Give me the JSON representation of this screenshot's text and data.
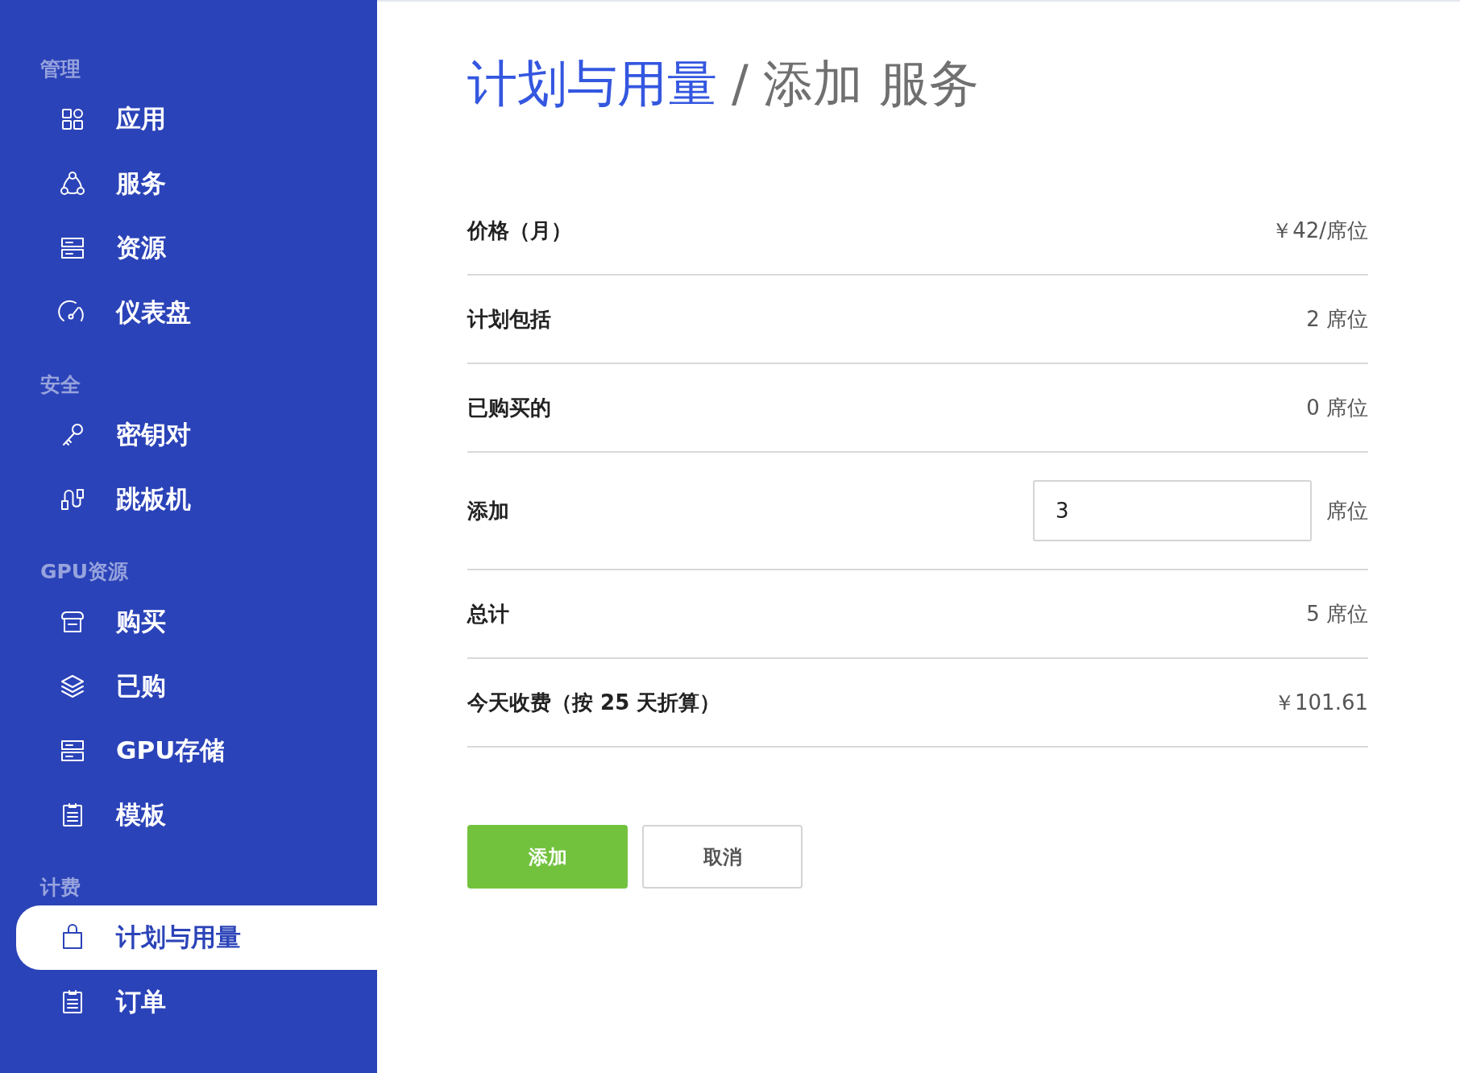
{
  "sidebar": {
    "sections": [
      {
        "heading": "管理",
        "items": [
          {
            "label": "应用",
            "kind": "grid",
            "selected": false
          },
          {
            "label": "服务",
            "kind": "nodes",
            "selected": false
          },
          {
            "label": "资源",
            "kind": "server",
            "selected": false
          },
          {
            "label": "仪表盘",
            "kind": "gauge",
            "selected": false
          }
        ]
      },
      {
        "heading": "安全",
        "items": [
          {
            "label": "密钥对",
            "kind": "key",
            "selected": false
          },
          {
            "label": "跳板机",
            "kind": "jump",
            "selected": false
          }
        ]
      },
      {
        "heading": "GPU资源",
        "items": [
          {
            "label": "购买",
            "kind": "store",
            "selected": false
          },
          {
            "label": "已购",
            "kind": "layers",
            "selected": false
          },
          {
            "label": "GPU存储",
            "kind": "server",
            "selected": false
          },
          {
            "label": "模板",
            "kind": "clipboard",
            "selected": false
          }
        ]
      },
      {
        "heading": "计费",
        "items": [
          {
            "label": "计划与用量",
            "kind": "bag",
            "selected": true
          },
          {
            "label": "订单",
            "kind": "clipboard",
            "selected": false
          }
        ]
      }
    ]
  },
  "breadcrumb": {
    "link": "计划与用量",
    "separator": "/",
    "current": "添加 服务"
  },
  "rows": [
    {
      "kind": "static",
      "label": "价格（月）",
      "value": "￥42/席位"
    },
    {
      "kind": "static",
      "label": "计划包括",
      "value": "2 席位"
    },
    {
      "kind": "static",
      "label": "已购买的",
      "value": "0 席位"
    },
    {
      "kind": "input",
      "label": "添加",
      "value": "3",
      "unit": "席位"
    },
    {
      "kind": "static",
      "label": "总计",
      "value": "5 席位"
    },
    {
      "kind": "static",
      "label": "今天收费（按 25 天折算）",
      "value": "￥101.61"
    }
  ],
  "buttons": [
    {
      "kind": "primary",
      "label": "添加"
    },
    {
      "kind": "secondary",
      "label": "取消"
    }
  ]
}
